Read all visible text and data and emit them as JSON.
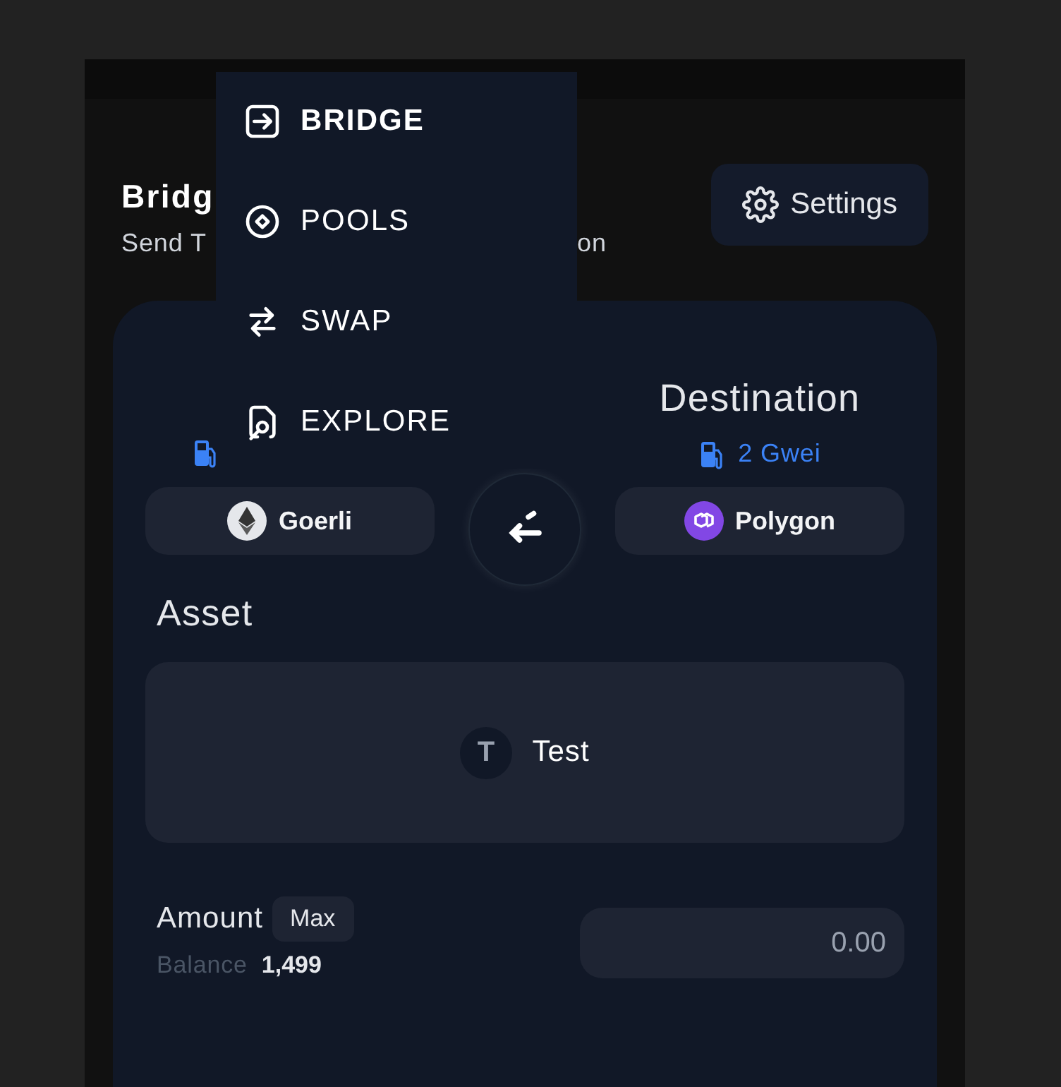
{
  "header": {
    "title": "Bridg",
    "subtitle_start": "Send T",
    "subtitle_end": "on",
    "settings_button": "Settings"
  },
  "menu": [
    {
      "label": "BRIDGE",
      "kind": "bridge",
      "selected": true
    },
    {
      "label": "POOLS",
      "kind": "pools",
      "selected": false
    },
    {
      "label": "SWAP",
      "kind": "swap",
      "selected": false
    },
    {
      "label": "EXPLORE",
      "kind": "explore",
      "selected": false
    }
  ],
  "origin": {
    "chain": "Goerli",
    "kind": "ethereum"
  },
  "destination": {
    "title": "Destination",
    "gas": "2 Gwei",
    "chain": "Polygon",
    "kind": "polygon"
  },
  "asset": {
    "label": "Asset",
    "token_letter": "T",
    "token": "Test"
  },
  "amount": {
    "label": "Amount",
    "max_button": "Max",
    "balance_label": "Balance",
    "balance": "1,499",
    "placeholder": "0.00"
  }
}
